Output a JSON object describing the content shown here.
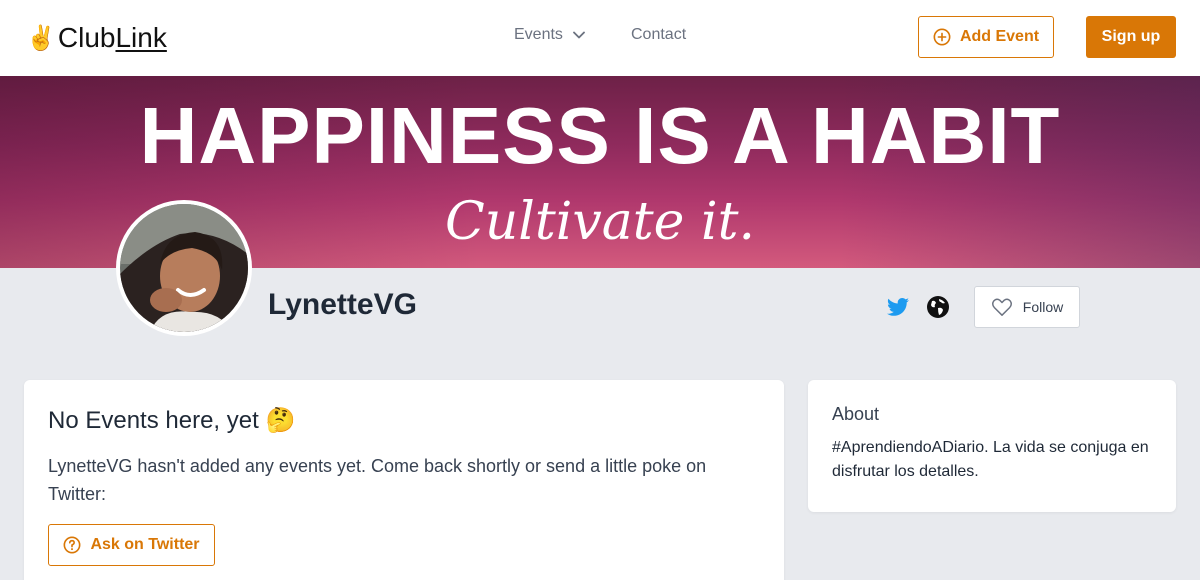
{
  "header": {
    "logo_text_club": "Club",
    "logo_text_link": "Link",
    "logo_icon": "victory-hand-icon",
    "nav_events_label": "Events",
    "nav_contact_label": "Contact",
    "add_event_label": "Add Event",
    "signup_label": "Sign up"
  },
  "banner": {
    "headline": "HAPPINESS IS A HABIT",
    "subline": "Cultivate it."
  },
  "profile": {
    "username": "LynetteVG",
    "follow_label": "Follow"
  },
  "events_card": {
    "title": "No Events here, yet",
    "title_emoji": "🤔",
    "message": "LynetteVG hasn't added any events yet. Come back shortly or send a little poke on Twitter:",
    "ask_label": "Ask on Twitter"
  },
  "about_card": {
    "title": "About",
    "text": "#AprendiendoADiario. La vida se conjuga en disfrutar los detalles."
  },
  "colors": {
    "accent": "#d97706",
    "twitter": "#1d9bf0",
    "page_bg": "#e8eaee"
  }
}
